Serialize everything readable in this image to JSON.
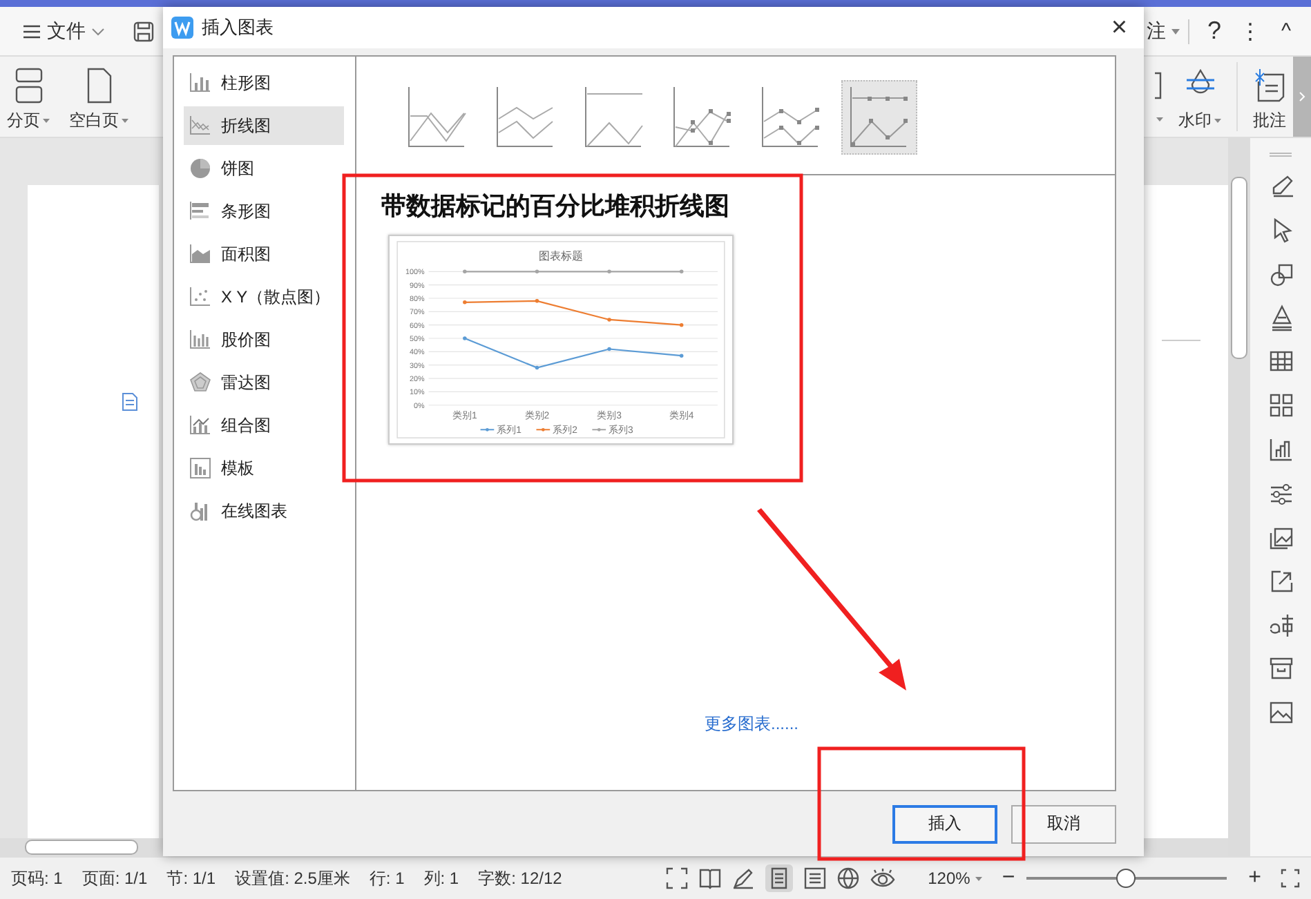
{
  "app": {
    "menu": "文件",
    "tab_cut": "注",
    "help": "?",
    "more": "⋮",
    "collapse": "^",
    "ribbon_left": [
      {
        "label": "分页"
      },
      {
        "label": "空白页"
      }
    ],
    "ribbon_right": [
      {
        "label": "水印"
      },
      {
        "label": "批注"
      }
    ]
  },
  "dialog": {
    "title": "插入图表",
    "close": "×",
    "categories": [
      {
        "label": "柱形图",
        "selected": false
      },
      {
        "label": "折线图",
        "selected": true
      },
      {
        "label": "饼图",
        "selected": false
      },
      {
        "label": "条形图",
        "selected": false
      },
      {
        "label": "面积图",
        "selected": false
      },
      {
        "label": "X Y（散点图）",
        "selected": false
      },
      {
        "label": "股价图",
        "selected": false
      },
      {
        "label": "雷达图",
        "selected": false
      },
      {
        "label": "组合图",
        "selected": false
      },
      {
        "label": "模板",
        "selected": false
      },
      {
        "label": "在线图表",
        "selected": false
      }
    ],
    "subtypes": [
      {
        "selected": false
      },
      {
        "selected": false
      },
      {
        "selected": false
      },
      {
        "selected": false
      },
      {
        "selected": false
      },
      {
        "selected": true
      }
    ],
    "heading": "带数据标记的百分比堆积折线图",
    "chart_data": {
      "type": "line",
      "title": "图表标题",
      "categories": [
        "类别1",
        "类别2",
        "类别3",
        "类别4"
      ],
      "series": [
        {
          "name": "系列1",
          "color": "#5b9bd5",
          "values": [
            50,
            28,
            42,
            37
          ]
        },
        {
          "name": "系列2",
          "color": "#ed7d31",
          "values": [
            77,
            78,
            64,
            60
          ]
        },
        {
          "name": "系列3",
          "color": "#a5a5a5",
          "values": [
            100,
            100,
            100,
            100
          ]
        }
      ],
      "ylim": [
        0,
        100
      ],
      "grid": true,
      "legend": true,
      "yticks": [
        {
          "value": 0,
          "label": "0%"
        },
        {
          "value": 10,
          "label": "10%"
        },
        {
          "value": 20,
          "label": "20%"
        },
        {
          "value": 30,
          "label": "30%"
        },
        {
          "value": 40,
          "label": "40%"
        },
        {
          "value": 50,
          "label": "50%"
        },
        {
          "value": 60,
          "label": "60%"
        },
        {
          "value": 70,
          "label": "70%"
        },
        {
          "value": 80,
          "label": "80%"
        },
        {
          "value": 90,
          "label": "90%"
        },
        {
          "value": 100,
          "label": "100%"
        }
      ]
    },
    "more_link": "更多图表......",
    "buttons": [
      {
        "label": "插入",
        "default": true
      },
      {
        "label": "取消",
        "default": false
      }
    ]
  },
  "status_bar": {
    "items": [
      "页码: 1",
      "页面: 1/1",
      "节: 1/1",
      "设置值: 2.5厘米",
      "行: 1",
      "列: 1",
      "字数: 12/12"
    ],
    "zoom": "120%",
    "zoom_slider": {
      "level": 0.5
    },
    "zoom_out": "−",
    "zoom_in": "+"
  }
}
